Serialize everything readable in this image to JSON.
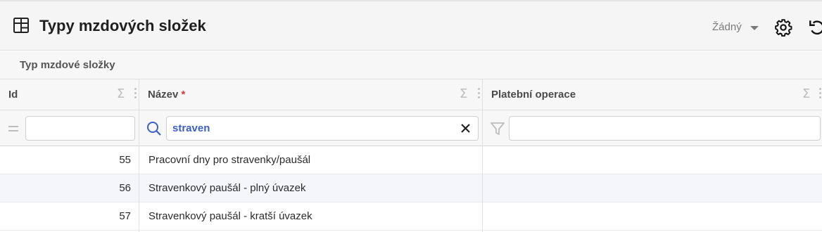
{
  "header": {
    "icon": "table-grid-icon",
    "title": "Typy mzdových složek",
    "view_select": "Žádný",
    "settings_icon": "gear-icon",
    "undo_icon": "undo-icon"
  },
  "group_bar": {
    "label": "Typ mzdové složky"
  },
  "columns": [
    {
      "label": "Id",
      "required": false
    },
    {
      "label": "Název",
      "required": true,
      "required_mark": "*"
    },
    {
      "label": "Platební operace",
      "required": false
    }
  ],
  "filters": {
    "id": {
      "operator_icon": "equals-icon",
      "value": ""
    },
    "name": {
      "operator_icon": "search-icon",
      "value": "straven",
      "clear_icon": "close-icon"
    },
    "payment": {
      "operator_icon": "filter-icon",
      "value": ""
    }
  },
  "rows": [
    {
      "id": "55",
      "name": "Pracovní dny pro stravenky/paušál",
      "payment": ""
    },
    {
      "id": "56",
      "name": "Stravenkový paušál - plný úvazek",
      "payment": ""
    },
    {
      "id": "57",
      "name": "Stravenkový paušál - kratší úvazek",
      "payment": ""
    }
  ],
  "colors": {
    "accent": "#3b5fc9",
    "required": "#e0383e",
    "row_alt": "#f4f6fb"
  }
}
